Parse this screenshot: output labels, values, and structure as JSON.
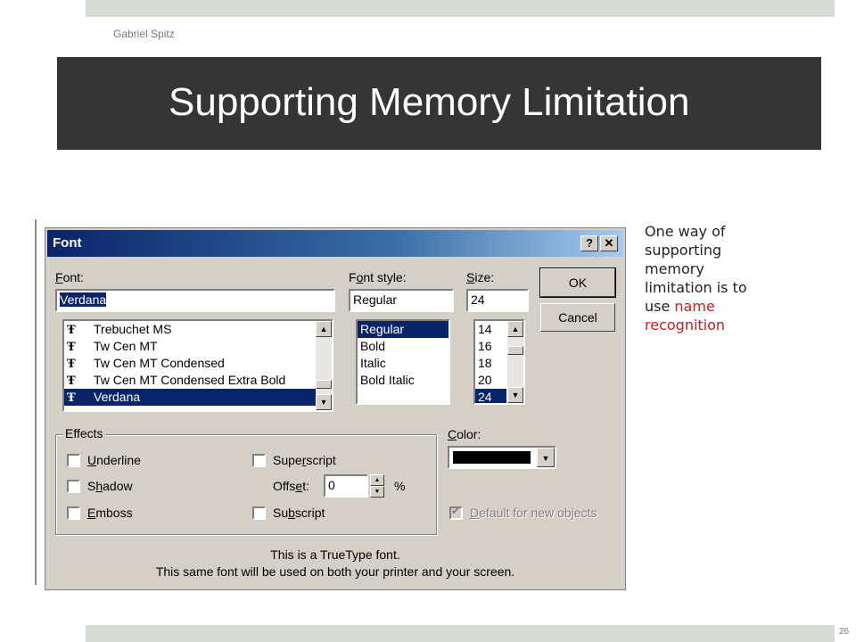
{
  "slide": {
    "author": "Gabriel Spitz",
    "title": "Supporting Memory Limitation",
    "page_number": "26",
    "side_text_part1": "One way of supporting memory limitation is to use ",
    "side_text_highlight": "name recognition"
  },
  "dialog": {
    "title": "Font",
    "help_button": "?",
    "close_button": "✕",
    "font_label_prefix": "",
    "font_label_u": "F",
    "font_label_rest": "ont:",
    "font_value": "Verdana",
    "font_list": [
      "Trebuchet MS",
      "Tw Cen MT",
      "Tw Cen MT Condensed",
      "Tw Cen MT Condensed Extra Bold",
      "Verdana"
    ],
    "font_list_selected": "Verdana",
    "style_label_prefix": "F",
    "style_label_u": "o",
    "style_label_rest": "nt style:",
    "style_value": "Regular",
    "style_list": [
      "Regular",
      "Bold",
      "Italic",
      "Bold Italic"
    ],
    "style_list_selected": "Regular",
    "size_label_u": "S",
    "size_label_rest": "ize:",
    "size_value": "24",
    "size_list": [
      "14",
      "16",
      "18",
      "20",
      "24"
    ],
    "size_list_selected": "24",
    "ok_button": "OK",
    "cancel_button": "Cancel",
    "effects_title": "Effects",
    "underline_u": "U",
    "underline_rest": "nderline",
    "shadow_prefix": "S",
    "shadow_u": "h",
    "shadow_rest": "adow",
    "emboss_u": "E",
    "emboss_rest": "mboss",
    "superscript_prefix": "Supe",
    "superscript_u": "r",
    "superscript_rest": "script",
    "offset_prefix": "Offs",
    "offset_u": "e",
    "offset_rest": "t:",
    "offset_value": "0",
    "offset_unit": "%",
    "subscript_prefix": "Su",
    "subscript_u": "b",
    "subscript_rest": "script",
    "color_u": "C",
    "color_rest": "olor:",
    "default_u": "D",
    "default_rest": "efault for new objects",
    "info_line1": "This is a TrueType font.",
    "info_line2": "This same font will be used on both your printer and your screen."
  }
}
